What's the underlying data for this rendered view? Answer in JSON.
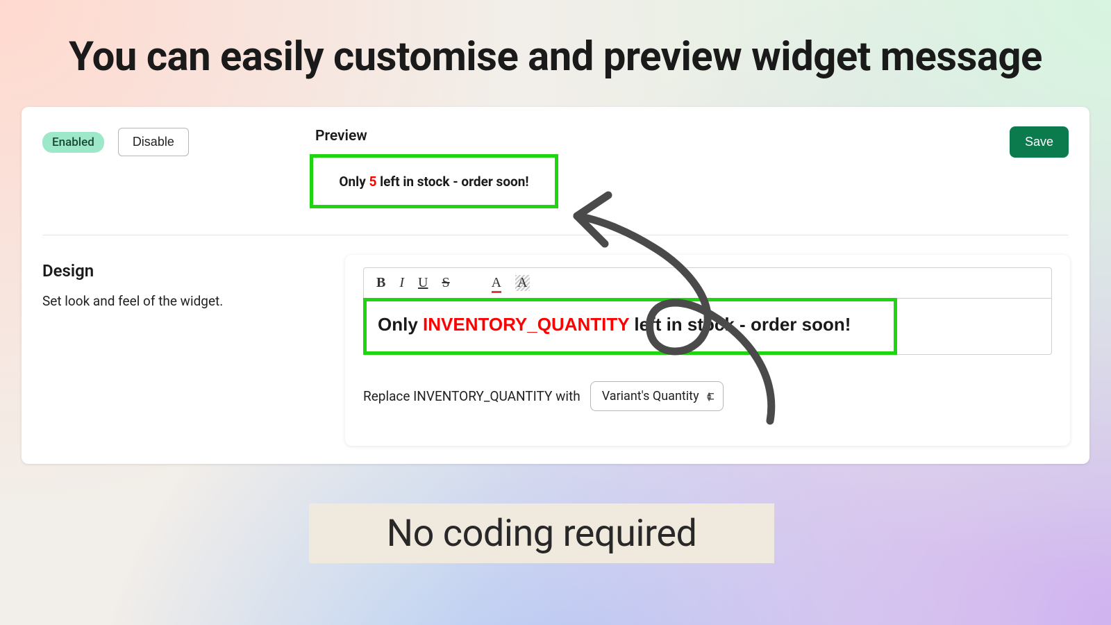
{
  "headline": "You can easily customise and preview widget message",
  "subheadline": "No coding required",
  "status": {
    "badge": "Enabled",
    "disable_label": "Disable"
  },
  "save_label": "Save",
  "preview": {
    "label": "Preview",
    "text_before": "Only ",
    "quantity": "5",
    "text_after": " left in stock - order soon!"
  },
  "design": {
    "title": "Design",
    "subtitle": "Set look and feel of the widget."
  },
  "editor": {
    "text_before": "Only ",
    "variable": "INVENTORY_QUANTITY",
    "text_after": " left in stock - order soon!",
    "replace_label": "Replace INVENTORY_QUANTITY with",
    "replace_value": "Variant's Quantity"
  },
  "toolbar_icons": {
    "bold": "B",
    "italic": "I",
    "underline": "U",
    "strike": "S",
    "color": "A",
    "highlight": "A"
  }
}
